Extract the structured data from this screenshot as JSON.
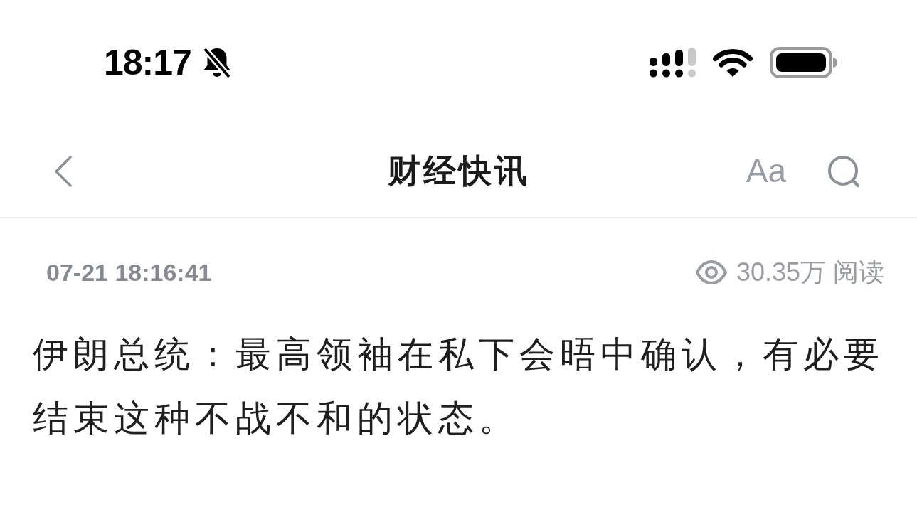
{
  "status_bar": {
    "time": "18:17",
    "silent": true
  },
  "nav": {
    "title": "财经快讯",
    "font_button": "Aa"
  },
  "article": {
    "timestamp": "07-21 18:16:41",
    "views": "30.35万",
    "views_label": "阅读",
    "body": "伊朗总统：最高领袖在私下会晤中确认，有必要结束这种不战不和的状态。"
  }
}
